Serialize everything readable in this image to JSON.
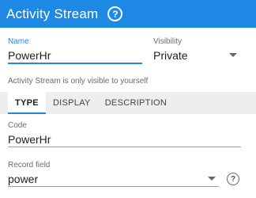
{
  "header": {
    "title": "Activity Stream",
    "help_glyph": "?"
  },
  "form": {
    "name": {
      "label": "Name",
      "value": "PowerHr"
    },
    "visibility": {
      "label": "Visibility",
      "value": "Private"
    },
    "note": "Activity Stream is only visible to yourself"
  },
  "tabs": [
    {
      "label": "TYPE",
      "active": true
    },
    {
      "label": "DISPLAY",
      "active": false
    },
    {
      "label": "DESCRIPTION",
      "active": false
    }
  ],
  "type_tab": {
    "code": {
      "label": "Code",
      "value": "PowerHr"
    },
    "record_field": {
      "label": "Record field",
      "value": "power"
    },
    "help_glyph": "?"
  },
  "colors": {
    "accent": "#1e88e5",
    "header_bg": "#1e88e5",
    "tab_bar_bg": "#eeeeee"
  },
  "icons": {
    "header_help": "help-circle-icon",
    "dropdown": "chevron-down-icon",
    "field_help": "help-circle-icon"
  }
}
